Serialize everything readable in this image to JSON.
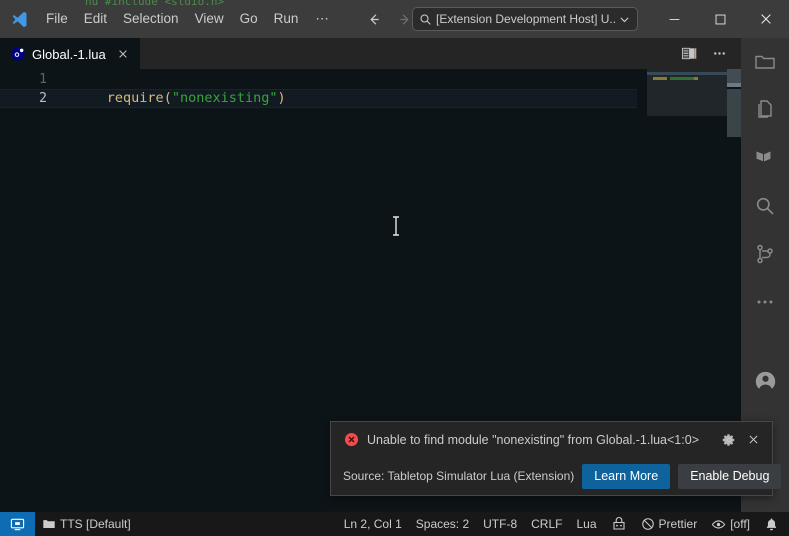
{
  "window": {
    "bleed_text": "nu   #include <stdio.h>",
    "logo_icon": "vscode-logo-icon"
  },
  "menubar": {
    "items": [
      {
        "label": "File",
        "name": "menu-file"
      },
      {
        "label": "Edit",
        "name": "menu-edit"
      },
      {
        "label": "Selection",
        "name": "menu-selection"
      },
      {
        "label": "View",
        "name": "menu-view"
      },
      {
        "label": "Go",
        "name": "menu-go"
      },
      {
        "label": "Run",
        "name": "menu-run"
      }
    ],
    "more_label": "⋯"
  },
  "navigation": {
    "back_icon": "arrow-left-icon",
    "forward_icon": "arrow-right-icon"
  },
  "quickinput": {
    "search_icon": "search-icon",
    "value": "[Extension Development Host] U...",
    "chevron_icon": "chevron-down-icon"
  },
  "windowcontrols": {
    "minimize_icon": "minimize-icon",
    "maximize_icon": "maximize-icon",
    "close_icon": "close-icon"
  },
  "activitybar": {
    "items": [
      {
        "name": "activity-explorer",
        "icon": "folder-icon",
        "label": "Explorer"
      },
      {
        "name": "activity-open-editors",
        "icon": "files-icon",
        "label": "Open Editors"
      },
      {
        "name": "activity-extension-panel",
        "icon": "terraform-icon",
        "label": "Extension"
      },
      {
        "name": "activity-search",
        "icon": "search-icon",
        "label": "Search"
      },
      {
        "name": "activity-source-control",
        "icon": "source-control-icon",
        "label": "Source Control"
      },
      {
        "name": "activity-additional-views",
        "icon": "ellipsis-icon",
        "label": "Additional Views"
      }
    ],
    "account": {
      "name": "activity-accounts",
      "icon": "account-icon",
      "label": "Accounts"
    }
  },
  "tabs": {
    "items": [
      {
        "label": "Global.-1.lua",
        "icon": "lua-file-icon",
        "close_icon": "close-icon",
        "active": true
      }
    ],
    "actions": [
      {
        "name": "split-editor-button",
        "icon": "open-changes-icon"
      },
      {
        "name": "more-editor-actions-button",
        "icon": "ellipsis-icon"
      }
    ]
  },
  "editor": {
    "lines": [
      {
        "number": "1",
        "active": false,
        "tokens": [
          {
            "text": "require",
            "type": "fn"
          },
          {
            "text": "(",
            "type": "paren"
          },
          {
            "text": "\"nonexisting\"",
            "type": "str"
          },
          {
            "text": ")",
            "type": "paren"
          }
        ]
      },
      {
        "number": "2",
        "active": true,
        "tokens": []
      }
    ],
    "mouse_cursor_icon": "text-ibeam-cursor"
  },
  "notification": {
    "severity_icon": "error-icon",
    "message": "Unable to find module \"nonexisting\" from Global.-1.lua<1:0>",
    "gear_icon": "gear-icon",
    "close_icon": "close-icon",
    "source": "Source: Tabletop Simulator Lua (Extension)",
    "primary_button": "Learn More",
    "secondary_button": "Enable Debug"
  },
  "statusbar": {
    "remote_icon": "remote-host-icon",
    "folder_icon": "folder-icon",
    "workspace": "TTS [Default]",
    "cursor_position": "Ln 2, Col 1",
    "indentation": "Spaces: 2",
    "encoding": "UTF-8",
    "eol": "CRLF",
    "language": "Lua",
    "liveshare_icon": "live-share-icon",
    "prettier_icon": "prohibited-icon",
    "prettier_label": "Prettier",
    "eye_icon": "eye-icon",
    "eye_label": "[off]",
    "bell_icon": "bell-icon"
  },
  "colors": {
    "titlebar_bg": "#3c3c3c",
    "activitybar_bg": "#333333",
    "tabbar_bg": "#252526",
    "editor_bg": "#0d1418",
    "statusbar_bg": "#181818",
    "remote_bg": "#0d6cb4",
    "accent_blue": "#0e639c",
    "error_red": "#f14c4c",
    "string_green": "#3ba33b",
    "function_gold": "#d7ba7d"
  }
}
